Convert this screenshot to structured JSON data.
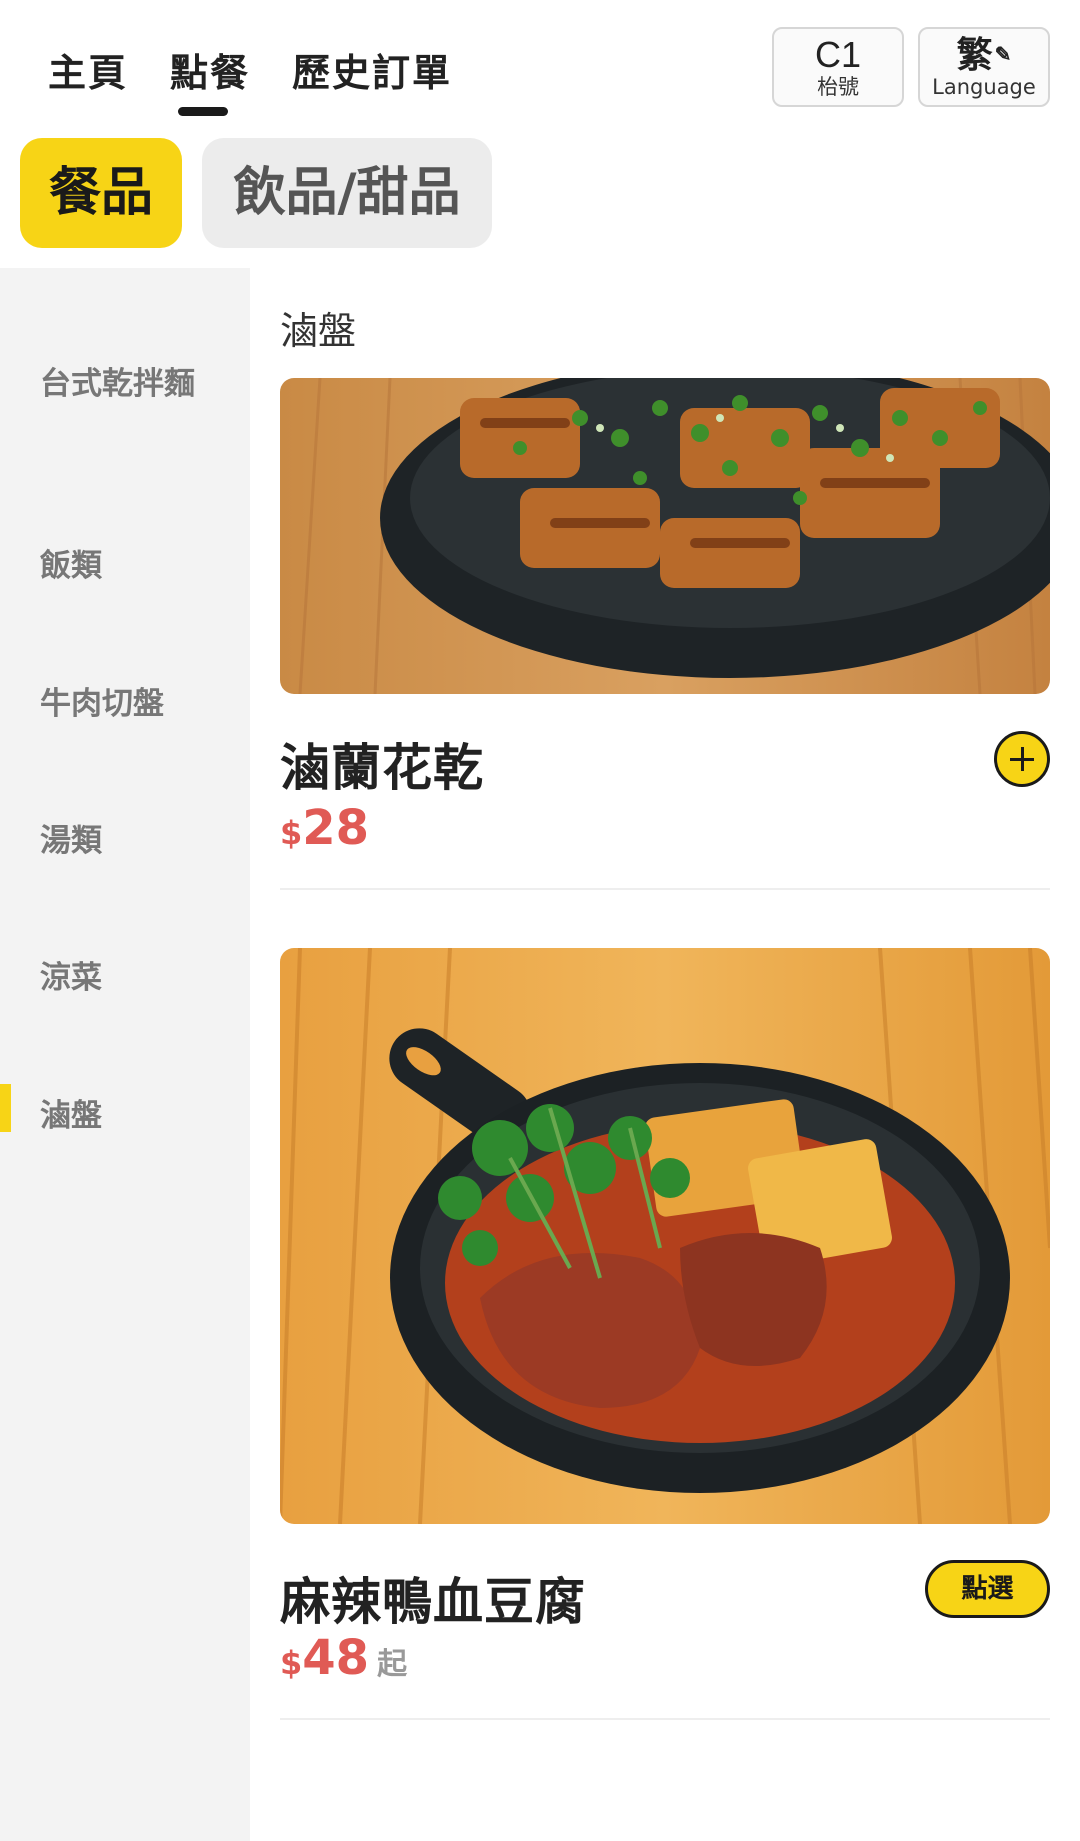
{
  "nav": {
    "tabs": [
      "主頁",
      "點餐",
      "歷史訂單"
    ],
    "active_tab": "點餐"
  },
  "table": {
    "code": "C1",
    "label": "枱號"
  },
  "language": {
    "code": "繁",
    "label": "Language"
  },
  "categories": [
    {
      "label": "餐品",
      "active": true
    },
    {
      "label": "飲品/甜品",
      "active": false
    }
  ],
  "sidebar": {
    "items": [
      {
        "label": "台式乾拌麵"
      },
      {
        "label": "飯類"
      },
      {
        "label": "牛肉切盤"
      },
      {
        "label": "湯類",
        "active": true
      },
      {
        "label": "涼菜"
      },
      {
        "label": "滷盤"
      }
    ]
  },
  "section": {
    "title": "滷盤"
  },
  "dishes": [
    {
      "name": "滷蘭花乾",
      "currency": "$",
      "price": "28",
      "price_suffix": "",
      "action_icon": "plus-icon"
    },
    {
      "name": "麻辣鴨血豆腐",
      "currency": "$",
      "price": "48",
      "price_suffix": "起",
      "action_label": "點選"
    }
  ],
  "colors": {
    "accent": "#f7d416",
    "price": "#e05a55",
    "sidebar_bg": "#f3f3f3"
  }
}
